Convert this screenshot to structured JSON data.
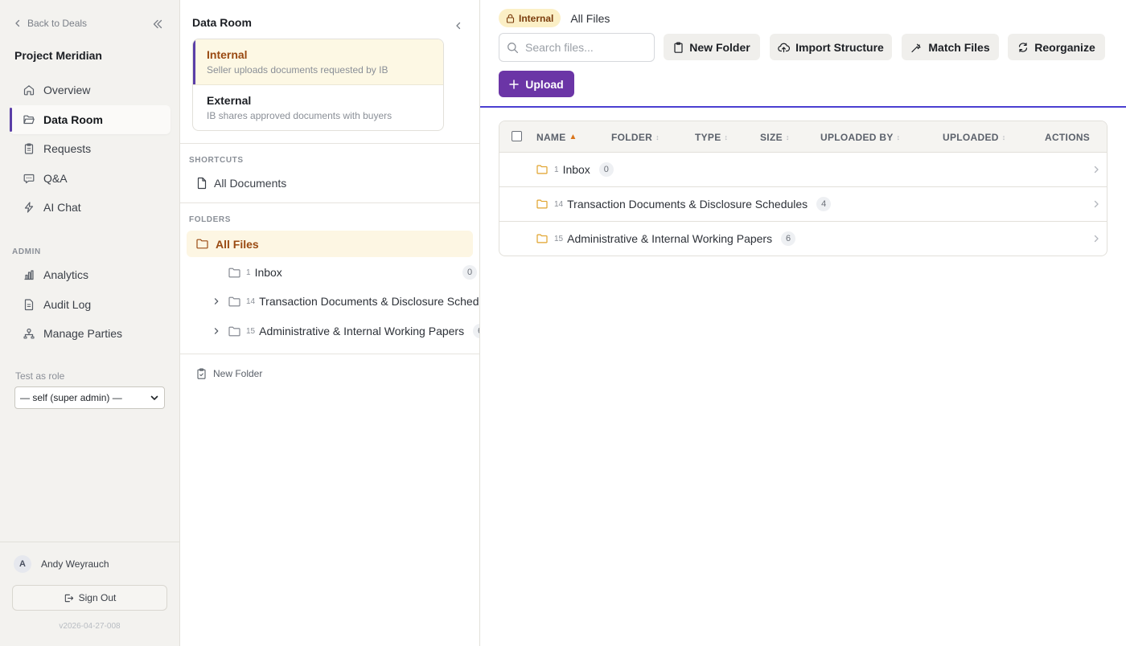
{
  "sidebar": {
    "back_label": "Back to Deals",
    "project_name": "Project Meridian",
    "nav": [
      {
        "label": "Overview",
        "icon": "home-icon"
      },
      {
        "label": "Data Room",
        "icon": "folder-open-icon",
        "active": true
      },
      {
        "label": "Requests",
        "icon": "clipboard-icon"
      },
      {
        "label": "Q&A",
        "icon": "chat-icon"
      },
      {
        "label": "AI Chat",
        "icon": "lightning-icon"
      }
    ],
    "admin_label": "ADMIN",
    "admin_nav": [
      {
        "label": "Analytics",
        "icon": "bar-chart-icon"
      },
      {
        "label": "Audit Log",
        "icon": "document-icon"
      },
      {
        "label": "Manage Parties",
        "icon": "org-chart-icon"
      }
    ],
    "role_label": "Test as role",
    "role_value": "— self (super admin) —",
    "user": {
      "initial": "A",
      "name": "Andy Weyrauch"
    },
    "sign_out_label": "Sign Out",
    "version": "v2026-04-27-008"
  },
  "data_room": {
    "title": "Data Room",
    "rooms": [
      {
        "title": "Internal",
        "subtitle": "Seller uploads documents requested by IB",
        "active": true
      },
      {
        "title": "External",
        "subtitle": "IB shares approved documents with buyers"
      }
    ],
    "shortcuts_label": "SHORTCUTS",
    "shortcut_all_documents": "All Documents",
    "folders_label": "FOLDERS",
    "folders_root": "All Files",
    "folders": [
      {
        "num": "1",
        "name": "Inbox",
        "count": "0",
        "expandable": false
      },
      {
        "num": "14",
        "name": "Transaction Documents & Disclosure Schedules",
        "count": "4",
        "expandable": true
      },
      {
        "num": "15",
        "name": "Administrative & Internal Working Papers",
        "count": "6",
        "expandable": true
      }
    ],
    "new_folder_label": "New Folder"
  },
  "main": {
    "crumb_pill": "Internal",
    "crumb_text": "All Files",
    "search_placeholder": "Search files...",
    "toolbar": {
      "new_folder": "New Folder",
      "import_structure": "Import Structure",
      "match_files": "Match Files",
      "reorganize": "Reorganize",
      "upload": "Upload"
    },
    "columns": [
      "NAME",
      "FOLDER",
      "TYPE",
      "SIZE",
      "UPLOADED BY",
      "UPLOADED",
      "ACTIONS"
    ],
    "sort_asc_glyph": "▲",
    "sort_glyph": "↕",
    "rows": [
      {
        "num": "1",
        "name": "Inbox",
        "count": "0"
      },
      {
        "num": "14",
        "name": "Transaction Documents & Disclosure Schedules",
        "count": "4"
      },
      {
        "num": "15",
        "name": "Administrative & Internal Working Papers",
        "count": "6"
      }
    ]
  },
  "colors": {
    "accent_purple": "#6b35a6",
    "active_bar": "#5b3fa8",
    "internal_amber": "#9a4a12",
    "folder_yellow": "#e0a22a",
    "rule_blue": "#4b3fd1"
  }
}
